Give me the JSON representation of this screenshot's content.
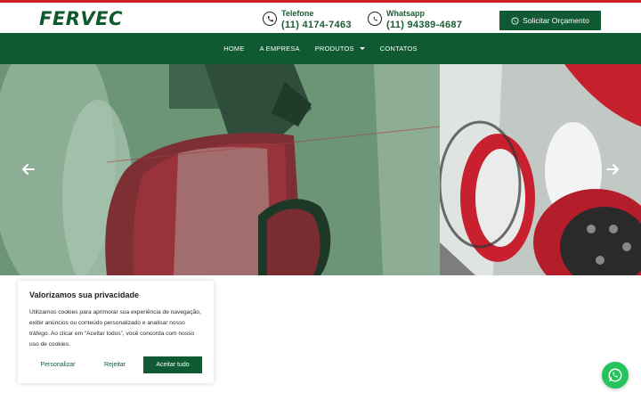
{
  "header": {
    "logo_text": "FERVEC",
    "phone": {
      "label": "Telefone",
      "value": "(11) 4174-7463",
      "icon": "phone-icon"
    },
    "whatsapp": {
      "label": "Whatsapp",
      "value": "(11) 94389-4687",
      "icon": "whatsapp-icon"
    },
    "quote_button": "Solicitar Orçamento"
  },
  "nav": {
    "items": [
      {
        "label": "HOME"
      },
      {
        "label": "A EMPRESA"
      },
      {
        "label": "PRODUTOS",
        "has_dropdown": true
      },
      {
        "label": "CONTATOS"
      }
    ]
  },
  "hero": {
    "prev_icon": "arrow-left-icon",
    "next_icon": "arrow-right-icon"
  },
  "cookie_banner": {
    "title": "Valorizamos sua privacidade",
    "text": "Utilizamos cookies para aprimorar sua experiência de navegação, exibir anúncios ou conteúdo personalizado e analisar nosso tráfego. Ao clicar em “Aceitar todos”, você concorda com nosso uso de cookies.",
    "customize": "Personalizar",
    "reject": "Rejeitar",
    "accept": "Aceitar tudo"
  },
  "colors": {
    "brand_green": "#0f5a32",
    "accent_red": "#d0202a",
    "whatsapp_green": "#25c35b"
  }
}
